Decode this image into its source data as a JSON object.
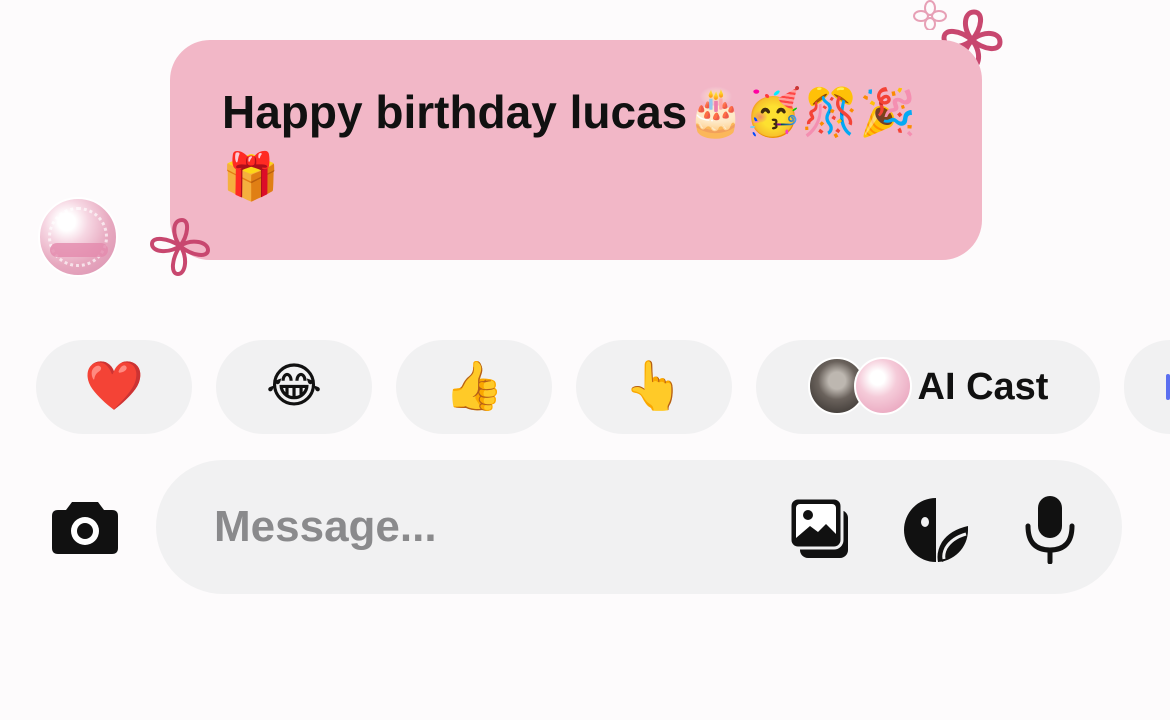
{
  "message": {
    "text": "Happy birthday lucas🎂🥳🎊🎉🎁"
  },
  "reactions": [
    {
      "emoji": "❤️",
      "icon": "heart-icon"
    },
    {
      "emoji": "😂",
      "icon": "tears-of-joy-icon"
    },
    {
      "emoji": "👍",
      "icon": "thumbs-up-icon"
    },
    {
      "emoji": "👆",
      "icon": "pointing-up-icon"
    }
  ],
  "cast": {
    "label": "AI Cast"
  },
  "composer": {
    "placeholder": "Message...",
    "value": ""
  },
  "colors": {
    "bubble": "#f2b7c7",
    "pill": "#f1f1f2",
    "flower": "#c8476f"
  }
}
